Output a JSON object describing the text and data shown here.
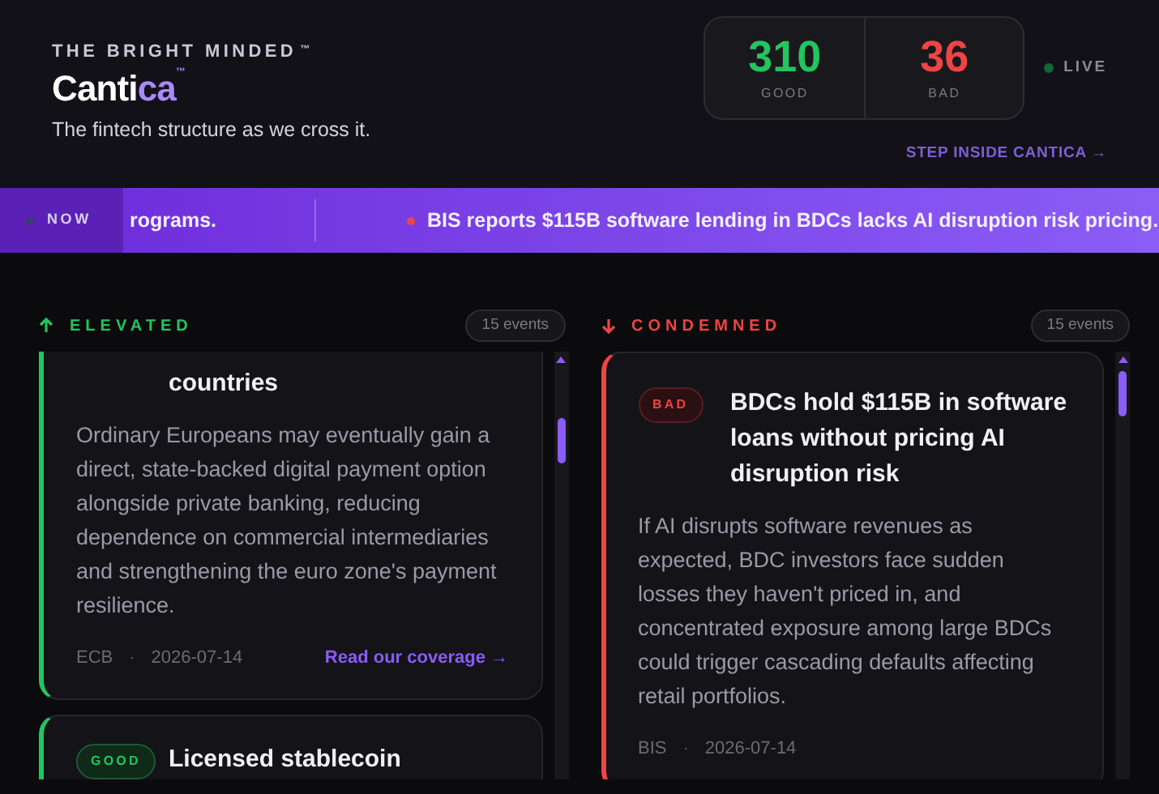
{
  "brand": {
    "kicker": "THE BRIGHT MINDED",
    "kicker_mark": "™",
    "name_plain": "Canti",
    "name_accent": "ca",
    "name_mark": "™",
    "tagline": "The fintech structure as we cross it."
  },
  "stats": [
    {
      "value": "310",
      "label": "GOOD",
      "kind": "good"
    },
    {
      "value": "36",
      "label": "BAD",
      "kind": "bad"
    }
  ],
  "live": {
    "label": "LIVE"
  },
  "cta": "STEP INSIDE CANTICA →",
  "ticker": {
    "label": "NOW",
    "items": [
      {
        "text": "rograms."
      },
      {
        "text": "BIS reports $115B software lending in BDCs lacks AI disruption risk pricing.",
        "color": "#ef4444"
      }
    ]
  },
  "columns": [
    {
      "title": "ELEVATED",
      "kind": "good",
      "count": "15 events",
      "cards": [
        {
          "kind": "good",
          "title": "countries",
          "body": "Ordinary Europeans may eventually gain a direct, state-backed digital payment option alongside private banking, reducing dependence on commercial intermediaries and strengthening the euro zone's payment resilience.",
          "source": "ECB",
          "separator": "·",
          "date": "2026-07-14",
          "link": "Read our coverage →"
        },
        {
          "kind": "good",
          "badge": "GOOD",
          "title": "Licensed stablecoin"
        }
      ]
    },
    {
      "title": "CONDEMNED",
      "kind": "bad",
      "count": "15 events",
      "cards": [
        {
          "kind": "bad",
          "badge": "BAD",
          "title": "BDCs hold $115B in software loans without pricing AI disruption risk",
          "body": "If AI disrupts software revenues as expected, BDC investors face sudden losses they haven't priced in, and concentrated exposure among large BDCs could trigger cascading defaults affecting retail portfolios.",
          "source": "BIS",
          "separator": "·",
          "date": "2026-07-14"
        }
      ]
    }
  ]
}
